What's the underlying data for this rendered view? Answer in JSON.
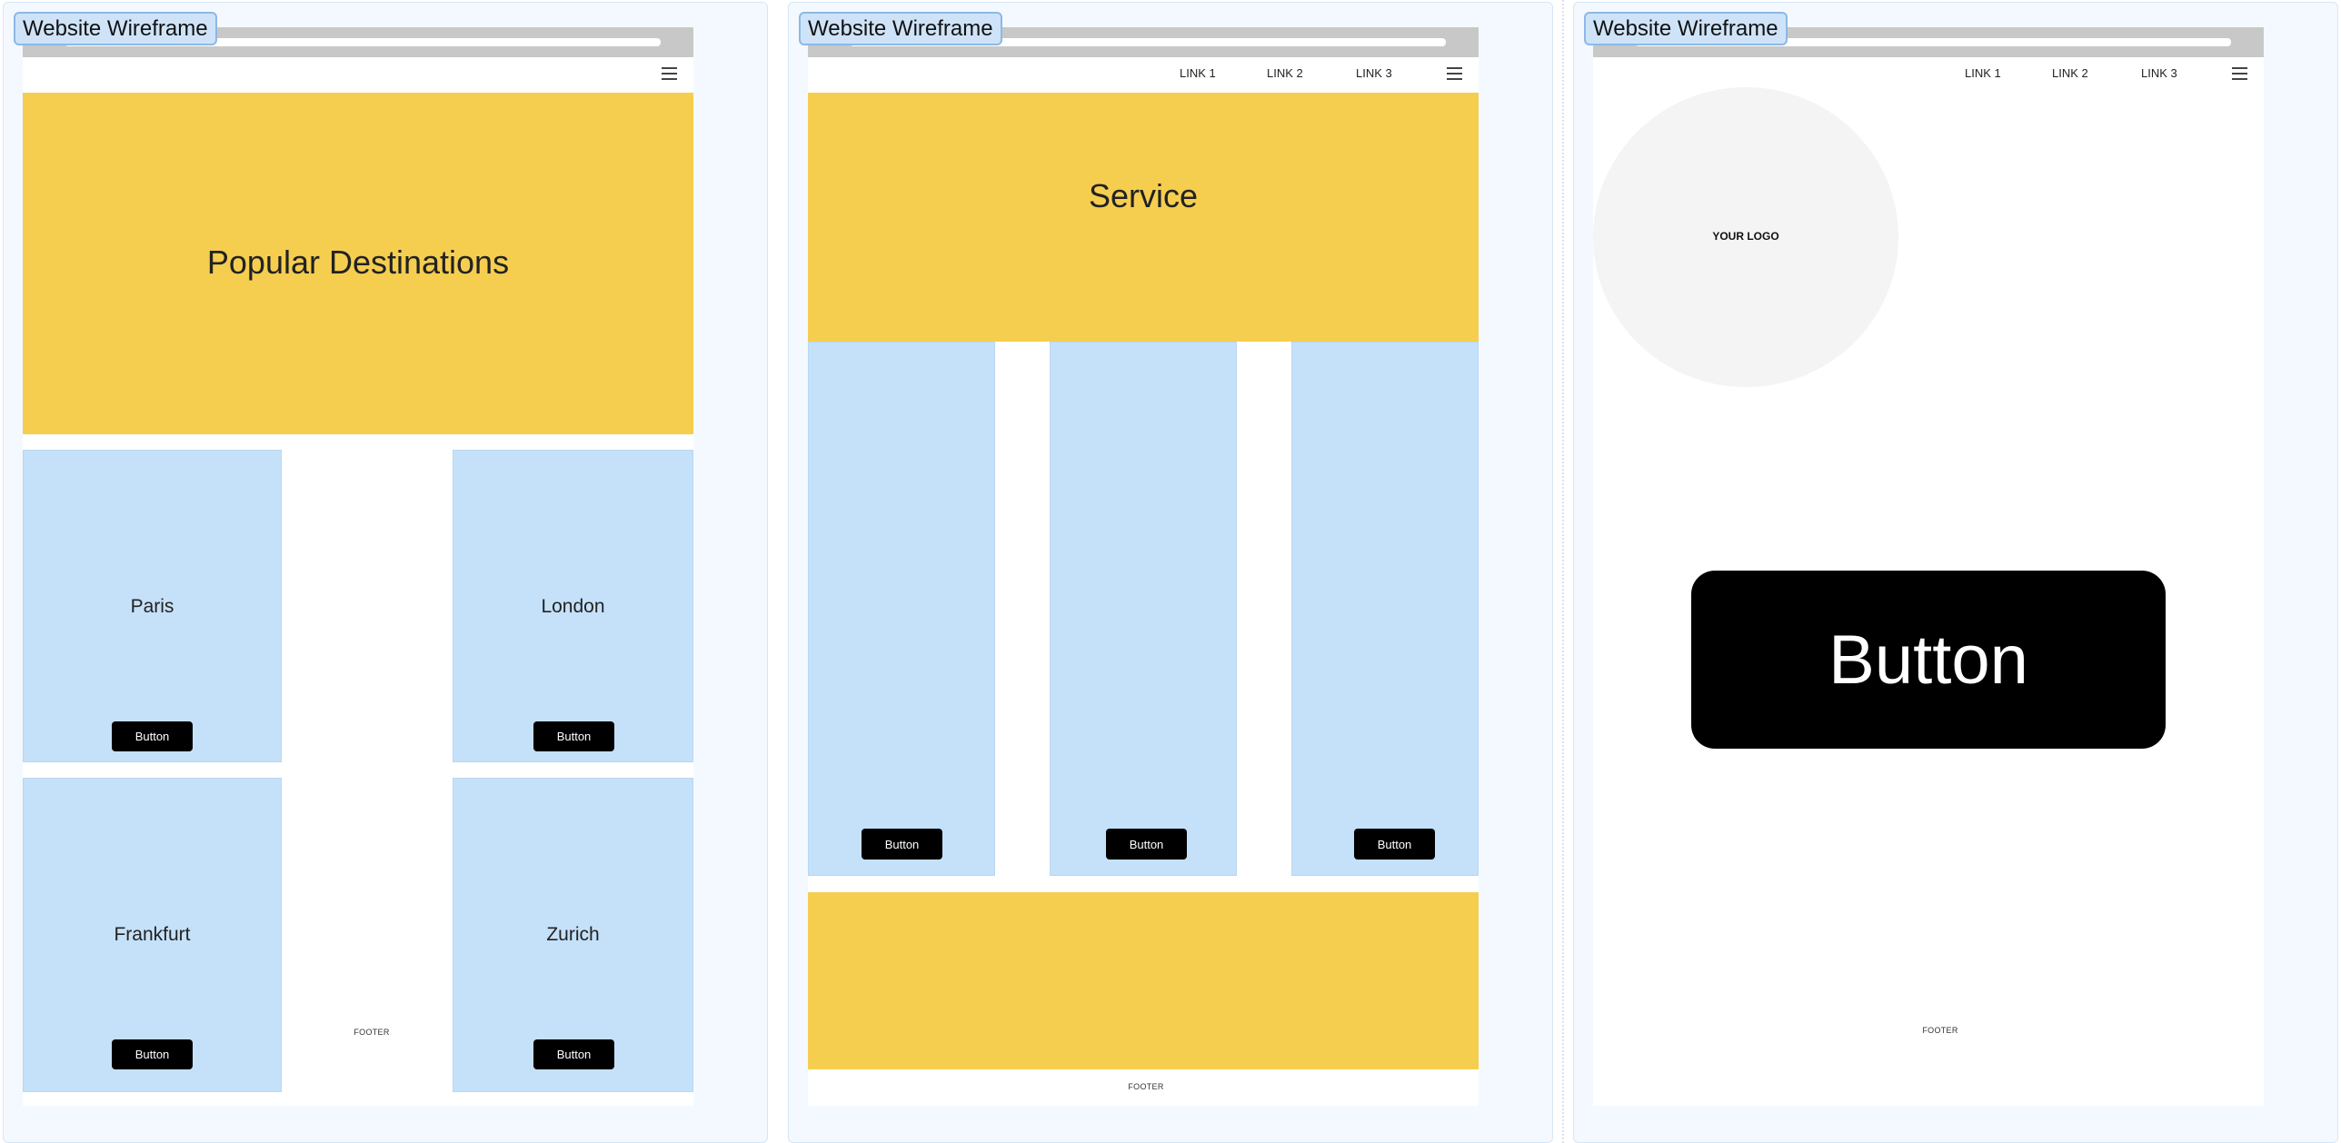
{
  "frames": [
    {
      "label": "Website Wireframe",
      "hero_title": "Popular Destinations",
      "cards": [
        {
          "title": "Paris",
          "button": "Button"
        },
        {
          "title": "London",
          "button": "Button"
        },
        {
          "title": "Frankfurt",
          "button": "Button"
        },
        {
          "title": "Zurich",
          "button": "Button"
        }
      ],
      "footer": "FOOTER"
    },
    {
      "label": "Website Wireframe",
      "nav_links": [
        "LINK 1",
        "LINK 2",
        "LINK 3"
      ],
      "hero_title": "Service",
      "columns": [
        {
          "button": "Button"
        },
        {
          "button": "Button"
        },
        {
          "button": "Button"
        }
      ],
      "footer": "FOOTER"
    },
    {
      "label": "Website Wireframe",
      "nav_links": [
        "LINK 1",
        "LINK 2",
        "LINK 3"
      ],
      "logo": "YOUR LOGO",
      "button": "Button",
      "footer": "FOOTER"
    }
  ],
  "icons": {
    "menu": "hamburger-menu-icon"
  },
  "colors": {
    "hero": "#f5ce50",
    "card": "#c5e1f9",
    "button": "#000000",
    "frame": "#f4f9ff"
  }
}
